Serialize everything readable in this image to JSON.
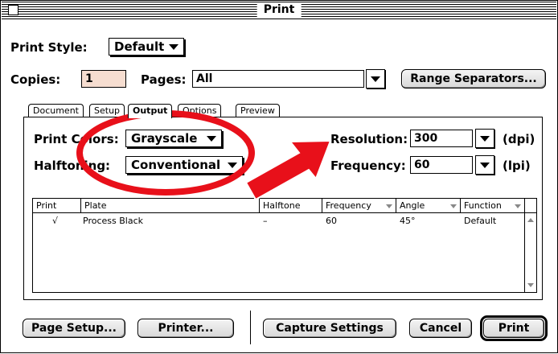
{
  "window": {
    "title": "Print"
  },
  "header": {
    "print_style_label": "Print Style:",
    "print_style_value": "Default",
    "copies_label": "Copies:",
    "copies_value": "1",
    "pages_label": "Pages:",
    "pages_value": "All",
    "range_separators_label": "Range Separators..."
  },
  "tabs": [
    {
      "label": "Document"
    },
    {
      "label": "Setup"
    },
    {
      "label": "Output"
    },
    {
      "label": "Options"
    },
    {
      "label": "Preview"
    }
  ],
  "output": {
    "print_colors_label": "Print Colors:",
    "print_colors_value": "Grayscale",
    "halftoning_label": "Halftoning:",
    "halftoning_value": "Conventional",
    "resolution_label": "Resolution:",
    "resolution_value": "300",
    "resolution_unit": "(dpi)",
    "frequency_label": "Frequency:",
    "frequency_value": "60",
    "frequency_unit": "(lpi)"
  },
  "plates_table": {
    "columns": [
      "Print",
      "Plate",
      "Halftone",
      "Frequency",
      "Angle",
      "Function"
    ],
    "rows": [
      {
        "print": "√",
        "plate": "Process Black",
        "halftone": "–",
        "frequency": "60",
        "angle": "45°",
        "function": "Default"
      }
    ]
  },
  "footer": {
    "page_setup_label": "Page Setup...",
    "printer_label": "Printer...",
    "capture_settings_label": "Capture Settings",
    "cancel_label": "Cancel",
    "print_label": "Print"
  },
  "annotations": {
    "highlight_color": "#e8101a",
    "ellipse_target": "print-colors-popup",
    "arrow_target": "resolution-frequency-fields"
  }
}
